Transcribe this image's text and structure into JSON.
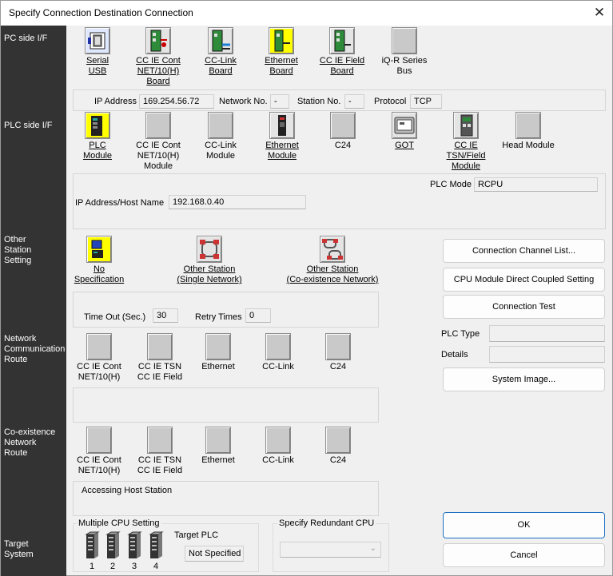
{
  "window": {
    "title": "Specify Connection Destination Connection",
    "close_glyph": "✕"
  },
  "side_labels": {
    "pc_side": "PC side I/F",
    "plc_side": "PLC side I/F",
    "other_station": "Other\nStation\nSetting",
    "network_route": "Network\nCommunication\nRoute",
    "coexistence_route": "Co-existence\nNetwork\nRoute",
    "target_system": "Target\nSystem"
  },
  "pc_side": {
    "items": [
      {
        "label": "Serial\nUSB",
        "icon": "serial-usb-icon"
      },
      {
        "label": "CC IE Cont\nNET/10(H)\nBoard",
        "icon": "board-icon"
      },
      {
        "label": "CC-Link\nBoard",
        "icon": "board-icon"
      },
      {
        "label": "Ethernet\nBoard",
        "icon": "board-icon"
      },
      {
        "label": "CC IE Field\nBoard",
        "icon": "board-icon"
      },
      {
        "label": "iQ-R Series\nBus",
        "icon": "blank-icon"
      }
    ],
    "ip_label": "IP Address",
    "ip_value": "169.254.56.72",
    "network_label": "Network No.",
    "network_value": "-",
    "station_label": "Station No.",
    "station_value": "-",
    "protocol_label": "Protocol",
    "protocol_value": "TCP"
  },
  "plc_side": {
    "items": [
      {
        "label": "PLC\nModule"
      },
      {
        "label": "CC IE Cont\nNET/10(H)\nModule"
      },
      {
        "label": "CC-Link\nModule"
      },
      {
        "label": "Ethernet\nModule"
      },
      {
        "label": "C24"
      },
      {
        "label": "GOT"
      },
      {
        "label": "CC IE\nTSN/Field\nModule"
      },
      {
        "label": "Head Module"
      }
    ],
    "plc_mode_label": "PLC Mode",
    "plc_mode_value": "RCPU",
    "ip_host_label": "IP Address/Host Name",
    "ip_host_value": "192.168.0.40"
  },
  "other_station": {
    "items": [
      {
        "label": "No Specification"
      },
      {
        "label": "Other Station\n(Single Network)"
      },
      {
        "label": "Other Station\n(Co-existence Network)"
      }
    ],
    "timeout_label": "Time Out (Sec.)",
    "timeout_value": "30",
    "retry_label": "Retry Times",
    "retry_value": "0"
  },
  "network_route": {
    "items": [
      {
        "label": "CC IE Cont\nNET/10(H)"
      },
      {
        "label": "CC IE TSN\nCC IE Field"
      },
      {
        "label": "Ethernet"
      },
      {
        "label": "CC-Link"
      },
      {
        "label": "C24"
      }
    ]
  },
  "coexistence_route": {
    "items": [
      {
        "label": "CC IE Cont\nNET/10(H)"
      },
      {
        "label": "CC IE TSN\nCC IE Field"
      },
      {
        "label": "Ethernet"
      },
      {
        "label": "CC-Link"
      },
      {
        "label": "C24"
      }
    ],
    "status_text": "Accessing Host Station"
  },
  "right_panel": {
    "connection_channel_list": "Connection Channel List...",
    "cpu_direct": "CPU Module Direct Coupled Setting",
    "connection_test": "Connection Test",
    "plc_type_label": "PLC Type",
    "plc_type_value": "",
    "details_label": "Details",
    "details_value": "",
    "system_image": "System Image...",
    "ok": "OK",
    "cancel": "Cancel"
  },
  "target_system": {
    "multiple_cpu_label": "Multiple CPU Setting",
    "cpu_numbers": [
      "1",
      "2",
      "3",
      "4"
    ],
    "target_plc_label": "Target PLC",
    "target_plc_value": "Not Specified",
    "redundant_label": "Specify Redundant CPU",
    "redundant_value": ""
  },
  "colors": {
    "sidebar": "#333333",
    "accent": "#1d6fc2",
    "yellow": "#ffff00"
  }
}
